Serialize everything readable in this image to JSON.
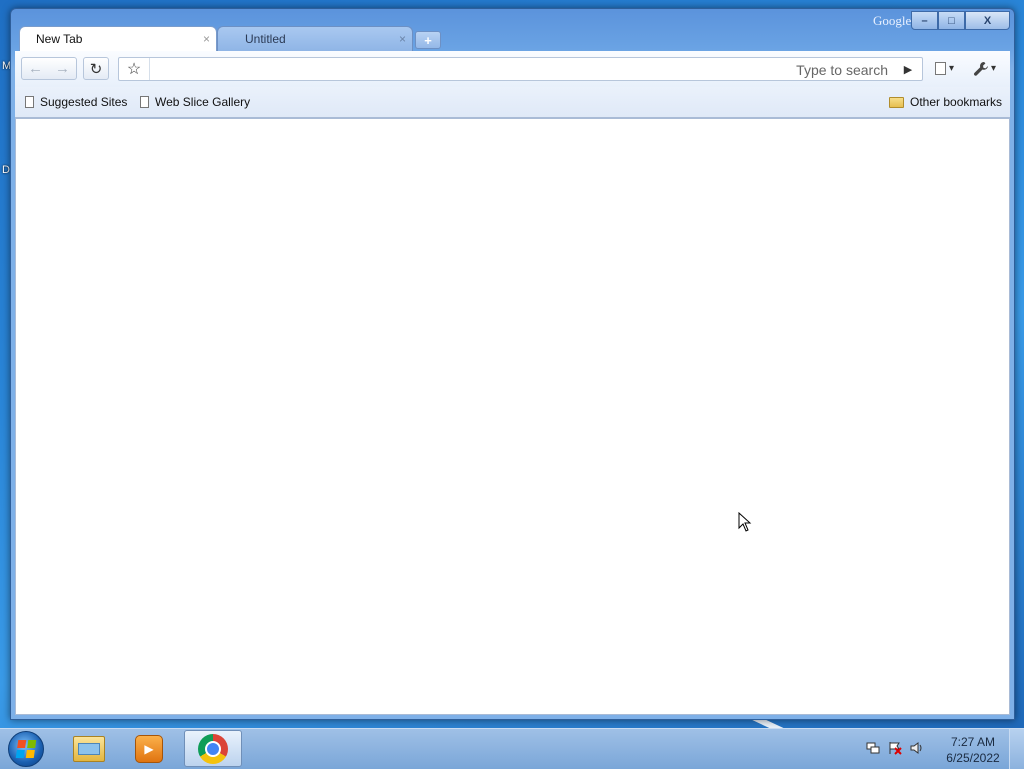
{
  "desktop": {
    "icon_labels": [
      "M",
      "D"
    ]
  },
  "window": {
    "brand_label": "Google",
    "caption": {
      "minimize": "–",
      "maximize": "□",
      "close": "X"
    }
  },
  "tabs": [
    {
      "label": "New Tab",
      "active": true,
      "close": "×"
    },
    {
      "label": "Untitled",
      "active": false,
      "close": "×"
    }
  ],
  "new_tab_glyph": "+",
  "toolbar": {
    "back": "←",
    "forward": "→",
    "reload": "↻",
    "star": "☆",
    "address_value": "",
    "search_hint": "Type to search",
    "go": "▶",
    "page_menu": "▾",
    "tools_menu": "▾"
  },
  "bookmarks": {
    "items": [
      {
        "label": "Suggested Sites"
      },
      {
        "label": "Web Slice Gallery"
      }
    ],
    "other": "Other bookmarks"
  },
  "taskbar": {
    "pinned": [
      "Windows Explorer",
      "Windows Media Player",
      "Google Chrome"
    ],
    "clock_time": "7:27 AM",
    "clock_date": "6/25/2022"
  },
  "colors": {
    "desktop": "#2a86d8",
    "window_frame": "#6aa3e4",
    "taskbar": "#8fb4e2"
  }
}
